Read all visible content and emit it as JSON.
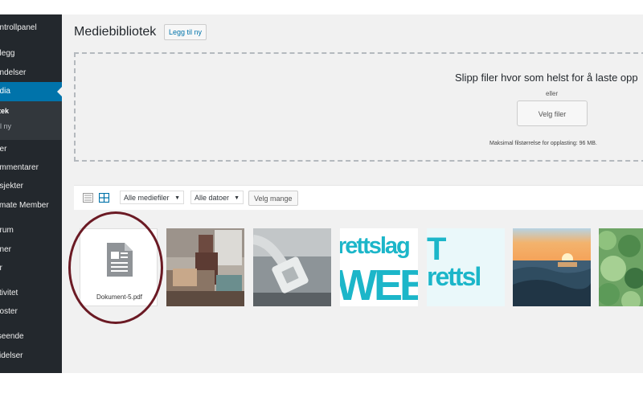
{
  "sidebar": {
    "items": [
      {
        "label": "ontrollpanel"
      },
      {
        "label": "nlegg"
      },
      {
        "label": "endelser"
      },
      {
        "label": "edia"
      },
      {
        "label": "der"
      },
      {
        "label": "ommentarer"
      },
      {
        "label": "osjekter"
      },
      {
        "label": "timate Member"
      },
      {
        "label": "orum"
      },
      {
        "label": "nner"
      },
      {
        "label": "ar"
      },
      {
        "label": "ktivitet"
      },
      {
        "label": "poster"
      },
      {
        "label": "tseende"
      },
      {
        "label": "videlser"
      }
    ],
    "submenu": [
      {
        "label": "tek"
      },
      {
        "label": "il ny"
      }
    ]
  },
  "header": {
    "title": "Mediebibliotek",
    "add_new": "Legg til ny"
  },
  "upload": {
    "title": "Slipp filer hvor som helst for å laste opp",
    "or": "eller",
    "button": "Velg filer",
    "max_size": "Maksimal filstørrelse for opplasting: 96 MB."
  },
  "toolbar": {
    "filter_type": "Alle mediefiler",
    "filter_date": "Alle datoer",
    "bulk_select": "Velg mange"
  },
  "media": [
    {
      "name": "Dokument-5.pdf",
      "type": "document"
    },
    {
      "type": "image",
      "subject": "workshop"
    },
    {
      "type": "image",
      "subject": "network-cable"
    },
    {
      "type": "image",
      "text1": "rettslag",
      "text2": "WEB"
    },
    {
      "type": "image",
      "text1": "T",
      "text2": "rettsl"
    },
    {
      "type": "image",
      "subject": "sunset-sea"
    },
    {
      "type": "image",
      "subject": "green-plants"
    }
  ],
  "colors": {
    "sidebar_bg": "#23282d",
    "active": "#0073aa",
    "cyan": "#1cb6c9",
    "annotation": "#6b1a24"
  }
}
